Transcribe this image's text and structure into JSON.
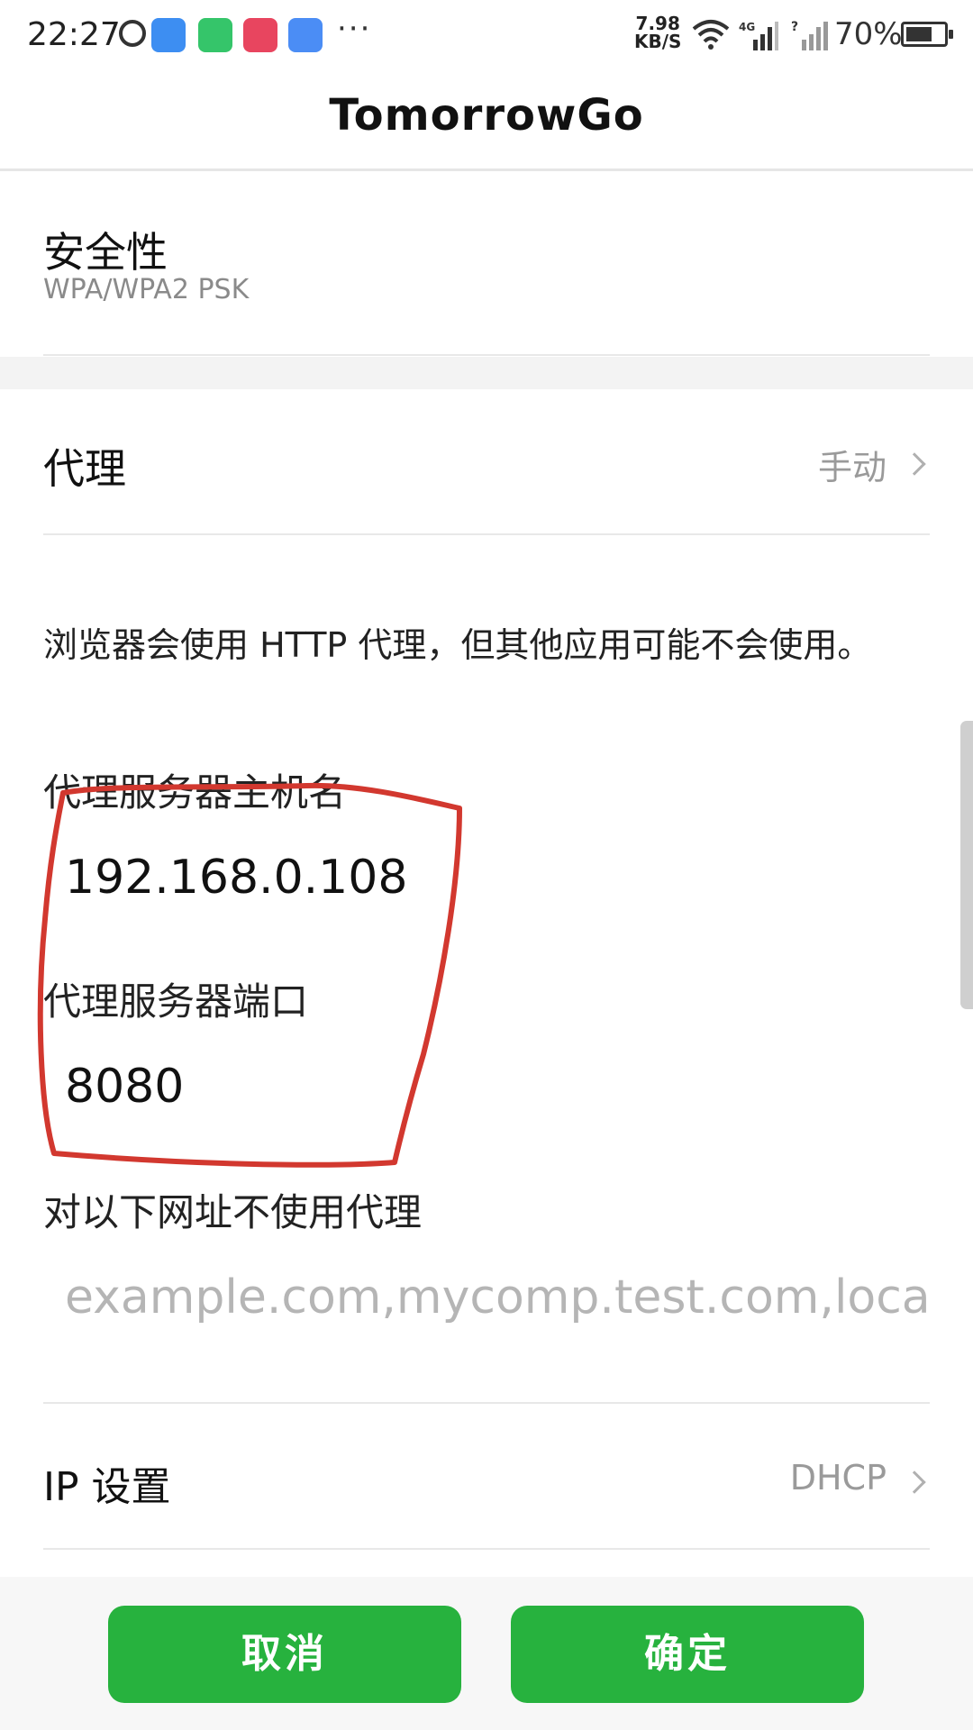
{
  "status_bar": {
    "time": "22:27",
    "more": "···",
    "speed_value": "7.98",
    "speed_unit": "KB/S",
    "battery_percent": "70%",
    "battery_level": 0.7,
    "icons": [
      "alarm-icon",
      "cloud-icon",
      "chat-icon",
      "red-app-icon",
      "shield-icon",
      "wifi-icon",
      "signal-4g-icon",
      "signal-icon",
      "battery-icon"
    ]
  },
  "header": {
    "title": "TomorrowGo"
  },
  "security": {
    "label": "安全性",
    "value": "WPA/WPA2 PSK"
  },
  "proxy": {
    "label": "代理",
    "value": "手动"
  },
  "note": "浏览器会使用 HTTP 代理，但其他应用可能不会使用。",
  "host": {
    "label": "代理服务器主机名",
    "value": "192.168.0.108"
  },
  "port": {
    "label": "代理服务器端口",
    "value": "8080"
  },
  "bypass": {
    "label": "对以下网址不使用代理",
    "placeholder": "example.com,mycomp.test.com,localho"
  },
  "ip": {
    "label": "IP 设置",
    "value": "DHCP"
  },
  "buttons": {
    "cancel": "取消",
    "ok": "确定"
  },
  "colors": {
    "accent": "#27b23e",
    "annotation": "#d2382f"
  }
}
